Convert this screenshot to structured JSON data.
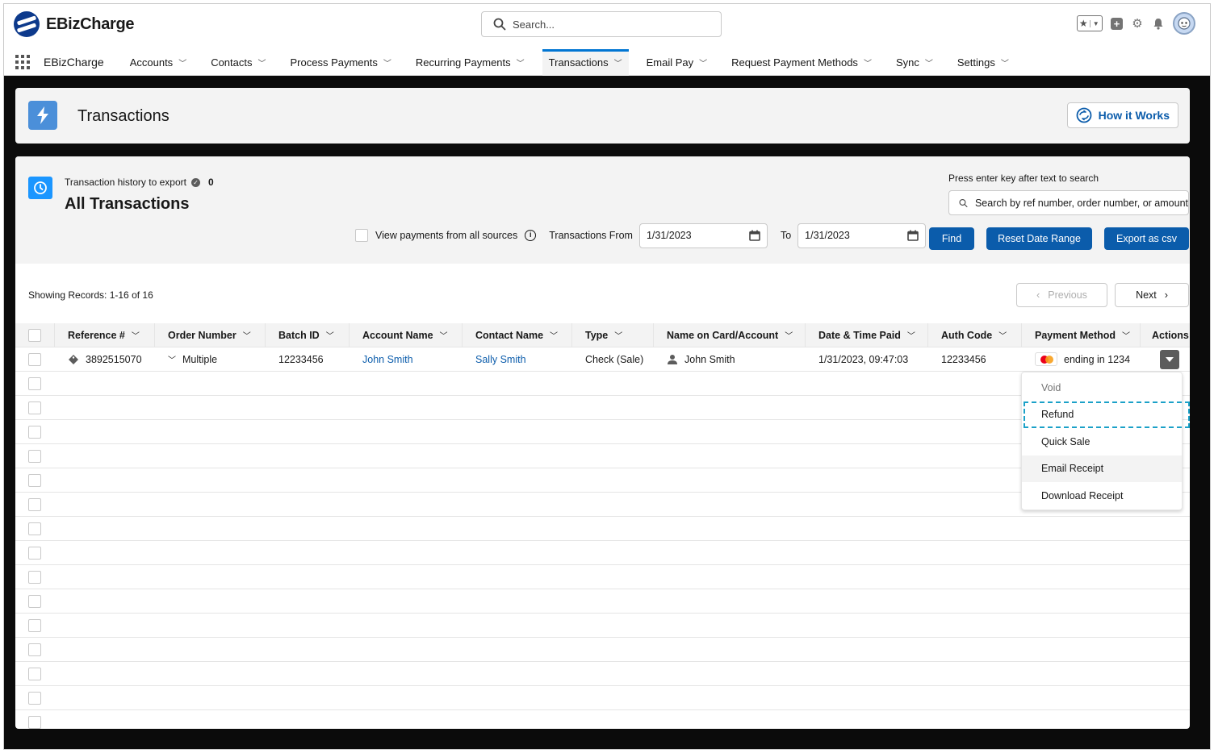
{
  "app": {
    "brand": "EBizCharge",
    "app_name": "EBizCharge",
    "global_search_placeholder": "Search..."
  },
  "nav": {
    "items": [
      {
        "label": "Accounts",
        "active": false
      },
      {
        "label": "Contacts",
        "active": false
      },
      {
        "label": "Process Payments",
        "active": false
      },
      {
        "label": "Recurring Payments",
        "active": false
      },
      {
        "label": "Transactions",
        "active": true
      },
      {
        "label": "Email Pay",
        "active": false
      },
      {
        "label": "Request Payment Methods",
        "active": false
      },
      {
        "label": "Sync",
        "active": false
      },
      {
        "label": "Settings",
        "active": false
      }
    ]
  },
  "page_header": {
    "title": "Transactions",
    "how_it_works": "How it Works"
  },
  "list": {
    "export_label": "Transaction history to export",
    "export_count": "0",
    "title": "All Transactions",
    "search_hint": "Press enter key after text to search",
    "search_placeholder": "Search by ref number, order number, or amount",
    "view_all_sources": "View payments from all sources",
    "from_label": "Transactions From",
    "from_date": "1/31/2023",
    "to_label": "To",
    "to_date": "1/31/2023",
    "find": "Find",
    "reset": "Reset Date Range",
    "export": "Export as csv",
    "records": "Showing Records: 1-16 of 16",
    "previous": "Previous",
    "next": "Next"
  },
  "table": {
    "columns": [
      "Reference #",
      "Order Number",
      "Batch ID",
      "Account Name",
      "Contact Name",
      "Type",
      "Name on Card/Account",
      "Date & Time Paid",
      "Auth Code",
      "Payment Method",
      "Actions"
    ],
    "rows": [
      {
        "reference": "3892515070",
        "order": "Multiple",
        "batch": "12233456",
        "account": "John Smith",
        "contact": "Sally Smith",
        "type": "Check (Sale)",
        "name_on_card": "John Smith",
        "date_paid": "1/31/2023, 09:47:03",
        "auth": "12233456",
        "payment_method": "ending in 1234"
      }
    ],
    "empty_rows": 15
  },
  "actions_menu": {
    "items": [
      "Void",
      "Refund",
      "Quick Sale",
      "Email Receipt",
      "Download Receipt"
    ]
  },
  "colors": {
    "brand_blue": "#0b5cab",
    "link_blue": "#0b5cab",
    "highlight": "#1ba1c8"
  }
}
